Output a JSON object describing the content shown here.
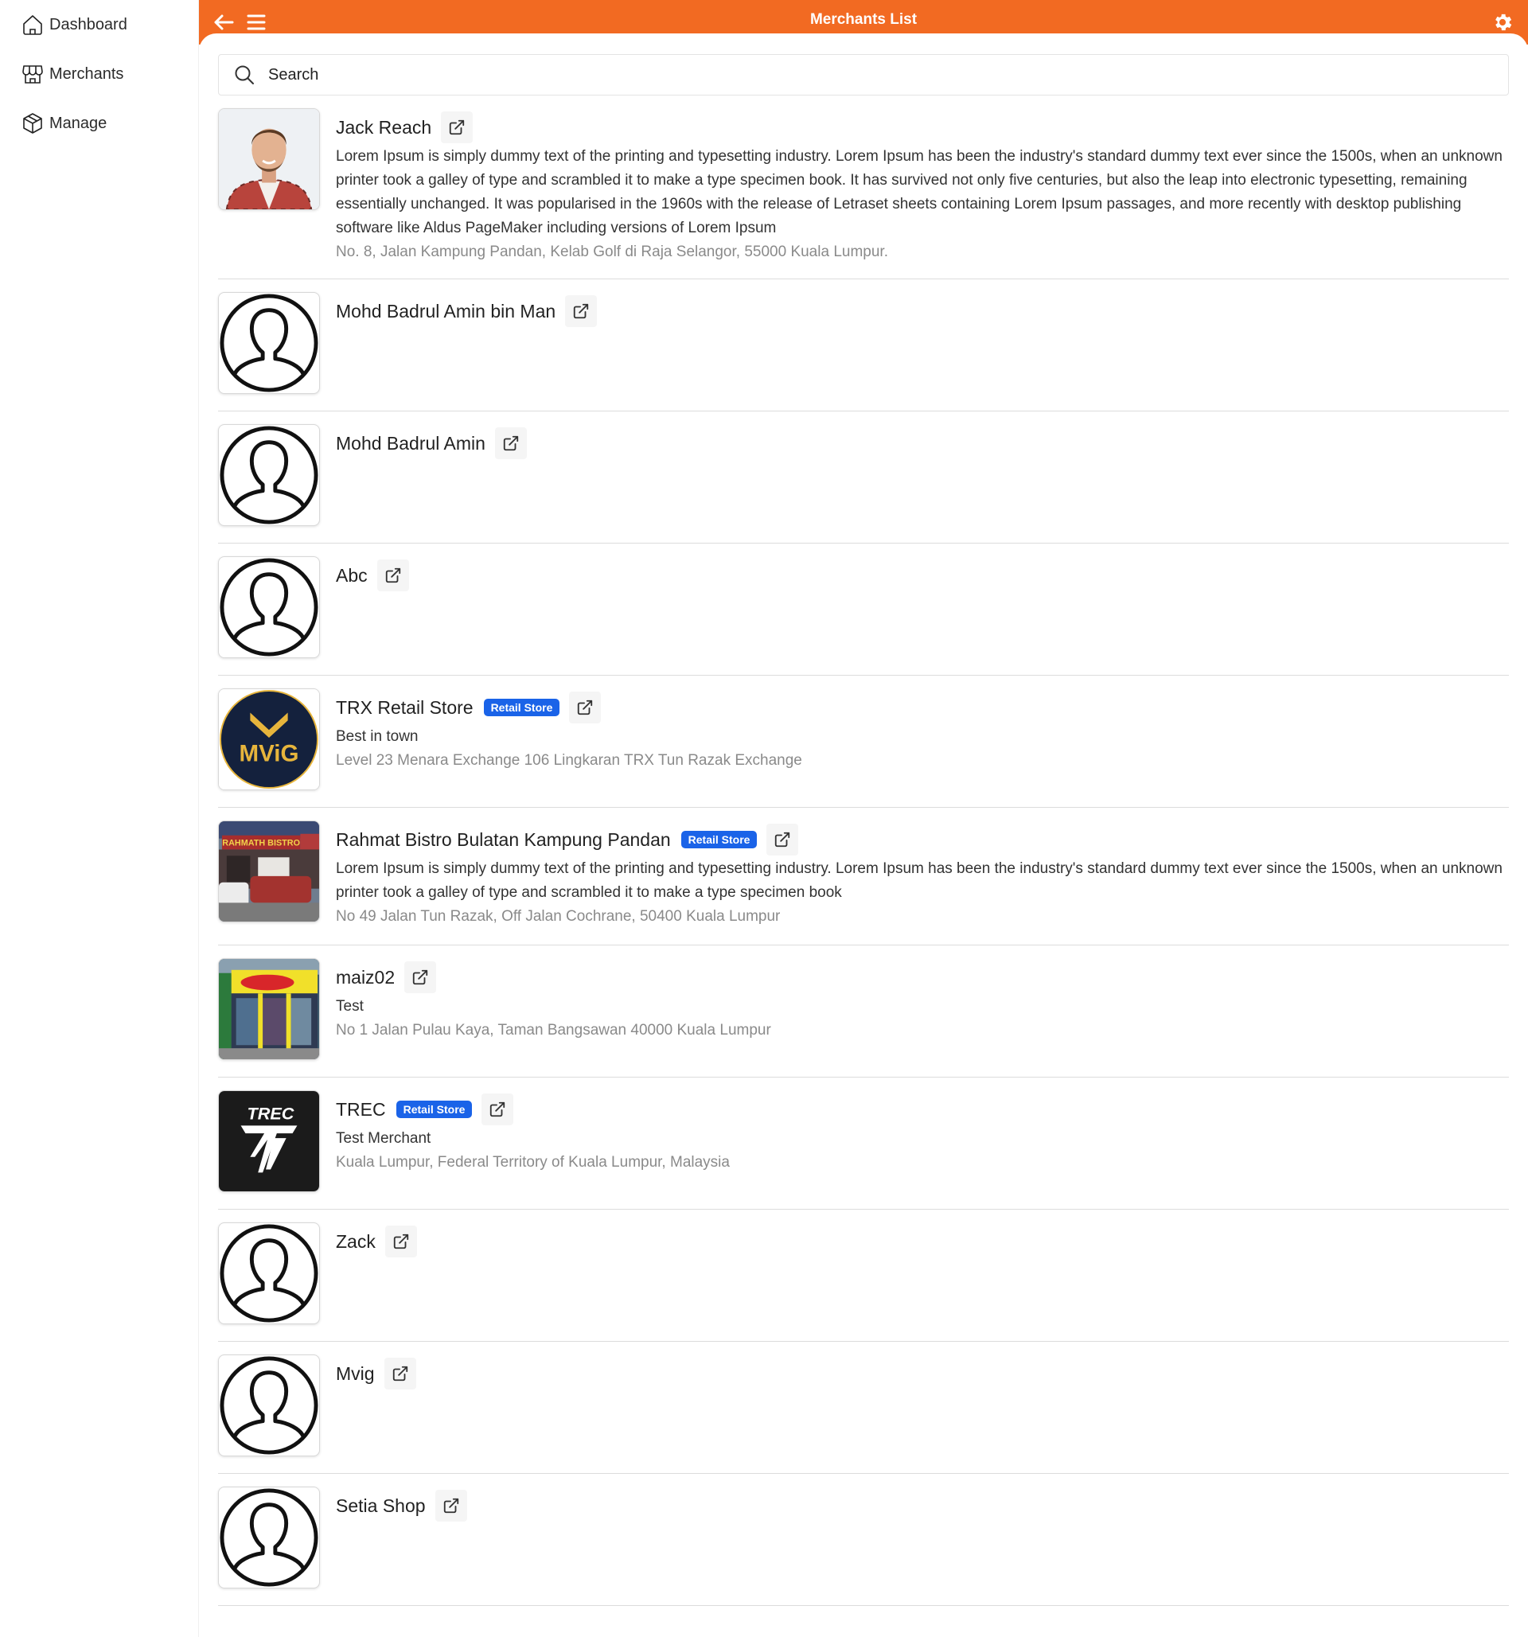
{
  "sidebar": {
    "items": [
      {
        "label": "Dashboard",
        "icon": "home-icon"
      },
      {
        "label": "Merchants",
        "icon": "store-icon"
      },
      {
        "label": "Manage",
        "icon": "box-icon"
      }
    ]
  },
  "header": {
    "title": "Merchants List",
    "accent_color": "#f26a22"
  },
  "search": {
    "placeholder": "Search",
    "value": ""
  },
  "badge_color": "#1a63e8",
  "merchants": [
    {
      "name": "Jack Reach",
      "badge": "",
      "description": "Lorem Ipsum is simply dummy text of the printing and typesetting industry. Lorem Ipsum has been the industry's standard dummy text ever since the 1500s, when an unknown printer took a galley of type and scrambled it to make a type specimen book. It has survived not only five centuries, but also the leap into electronic typesetting, remaining essentially unchanged. It was popularised in the 1960s with the release of Letraset sheets containing Lorem Ipsum passages, and more recently with desktop publishing software like Aldus PageMaker including versions of Lorem Ipsum",
      "address": "No. 8, Jalan Kampung Pandan, Kelab Golf di Raja Selangor, 55000 Kuala Lumpur.",
      "avatar": "photo-person"
    },
    {
      "name": "Mohd Badrul Amin bin Man",
      "badge": "",
      "description": "",
      "address": "",
      "avatar": "default-user"
    },
    {
      "name": "Mohd Badrul Amin",
      "badge": "",
      "description": "",
      "address": "",
      "avatar": "default-user"
    },
    {
      "name": "Abc",
      "badge": "",
      "description": "",
      "address": "",
      "avatar": "default-user"
    },
    {
      "name": "TRX Retail Store",
      "badge": "Retail Store",
      "description": "Best in town",
      "address": "Level 23 Menara Exchange 106 Lingkaran TRX Tun Razak Exchange",
      "avatar": "mvig-logo",
      "logo_text": "MViG"
    },
    {
      "name": "Rahmat Bistro Bulatan Kampung Pandan",
      "badge": "Retail Store",
      "description": "Lorem Ipsum is simply dummy text of the printing and typesetting industry. Lorem Ipsum has been the industry's standard dummy text ever since the 1500s, when an unknown printer took a galley of type and scrambled it to make a type specimen book",
      "address": "No 49 Jalan Tun Razak, Off Jalan Cochrane, 50400 Kuala Lumpur",
      "avatar": "photo-restaurant",
      "logo_text": "RAHMATH BISTRO"
    },
    {
      "name": "maiz02",
      "badge": "",
      "description": "Test",
      "address": "No 1 Jalan Pulau Kaya, Taman Bangsawan 40000 Kuala Lumpur",
      "avatar": "photo-shopfront"
    },
    {
      "name": "TREC",
      "badge": "Retail Store",
      "description": "Test Merchant",
      "address": "Kuala Lumpur, Federal Territory of Kuala Lumpur, Malaysia",
      "avatar": "trec-logo",
      "logo_text": "TREC"
    },
    {
      "name": "Zack",
      "badge": "",
      "description": "",
      "address": "",
      "avatar": "default-user"
    },
    {
      "name": "Mvig",
      "badge": "",
      "description": "",
      "address": "",
      "avatar": "default-user"
    },
    {
      "name": "Setia Shop",
      "badge": "",
      "description": "",
      "address": "",
      "avatar": "default-user"
    }
  ]
}
